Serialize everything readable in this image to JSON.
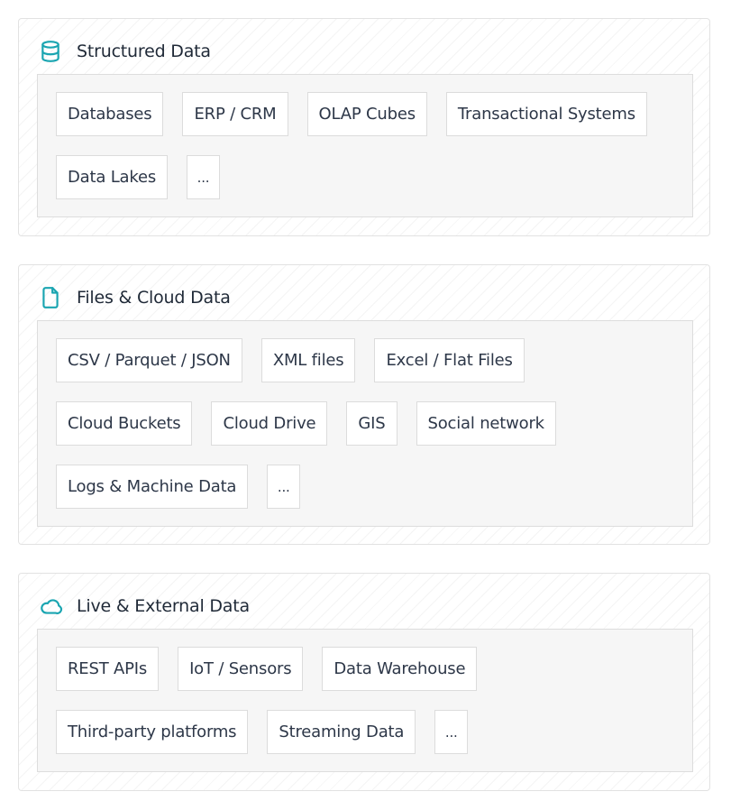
{
  "colors": {
    "accent": "#1aa5b1",
    "text": "#2d3748",
    "border": "#dcdcdc",
    "panel": "#f6f6f6"
  },
  "sections": [
    {
      "title": "Structured Data",
      "icon": "database-icon",
      "rows": [
        [
          "Databases",
          "ERP / CRM",
          "OLAP Cubes",
          "Transactional Systems"
        ],
        [
          "Data Lakes",
          "..."
        ]
      ]
    },
    {
      "title": "Files & Cloud Data",
      "icon": "file-icon",
      "rows": [
        [
          "CSV / Parquet / JSON",
          "XML files",
          "Excel / Flat Files"
        ],
        [
          "Cloud Buckets",
          "Cloud Drive",
          "GIS",
          "Social network"
        ],
        [
          "Logs & Machine Data",
          "..."
        ]
      ]
    },
    {
      "title": "Live & External Data",
      "icon": "cloud-icon",
      "rows": [
        [
          "REST APIs",
          "IoT / Sensors",
          "Data Warehouse"
        ],
        [
          "Third-party platforms",
          "Streaming Data",
          "..."
        ]
      ]
    }
  ]
}
